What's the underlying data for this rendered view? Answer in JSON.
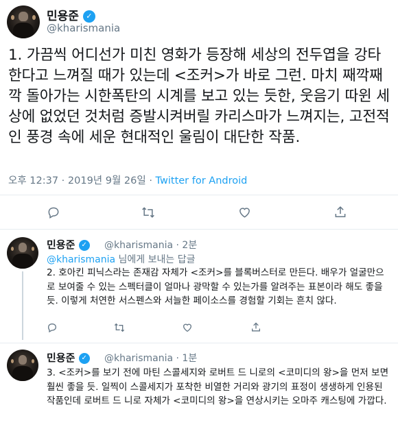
{
  "main": {
    "display_name": "민용준",
    "handle": "@kharismania",
    "text": "1. 가끔씩 어디선가 미친 영화가 등장해 세상의 전두엽을 강타한다고 느껴질 때가 있는데 <조커>가 바로 그런. 마치 째깍째깍 돌아가는 시한폭탄의 시계를 보고 있는 듯한, 웃음기 따윈 세상에 없었던 것처럼 증발시켜버릴 카리스마가 느껴지는, 고전적인 풍경 속에 세운 현대적인 울림이 대단한 작품.",
    "time": "오후 12:37 · 2019년 9월 26일 · ",
    "source": "Twitter for Android"
  },
  "replies": [
    {
      "display_name": "민용준",
      "handle": "@kharismania · 2분",
      "reply_to_mention": "@kharismania",
      "reply_to_suffix": " 님에게 보내는 답글",
      "text": "2. 호아킨 피닉스라는 존재감 자체가 <조커>를 블록버스터로 만든다. 배우가 얼굴만으로 보여줄 수 있는 스펙터클이 얼마나 광막할 수 있는가를 알려주는 표본이라 해도 좋을 듯. 이렇게 처연한 서스펜스와 서늘한 페이소스를 경험할 기회는 흔치 않다."
    },
    {
      "display_name": "민용준",
      "handle": "@kharismania · 1분",
      "text": "3. <조커>를 보기 전에 마틴 스콜세지와 로버트 드 니로의 <코미디의 왕>을 먼저 보면 훨씬 좋을 듯. 일찍이 스콜세지가 포착한 비열한 거리와 광기의 표정이 생생하게 인용된 작품인데 로버트 드 니로 자체가 <코미디의 왕>을 연상시키는 오마주 캐스팅에 가깝다."
    }
  ],
  "icons": {
    "reply": "reply-icon",
    "retweet": "retweet-icon",
    "like": "like-icon",
    "share": "share-icon",
    "verified": "verified-badge"
  },
  "colors": {
    "accent": "#1da1f2",
    "muted": "#657786",
    "text": "#14171a"
  }
}
